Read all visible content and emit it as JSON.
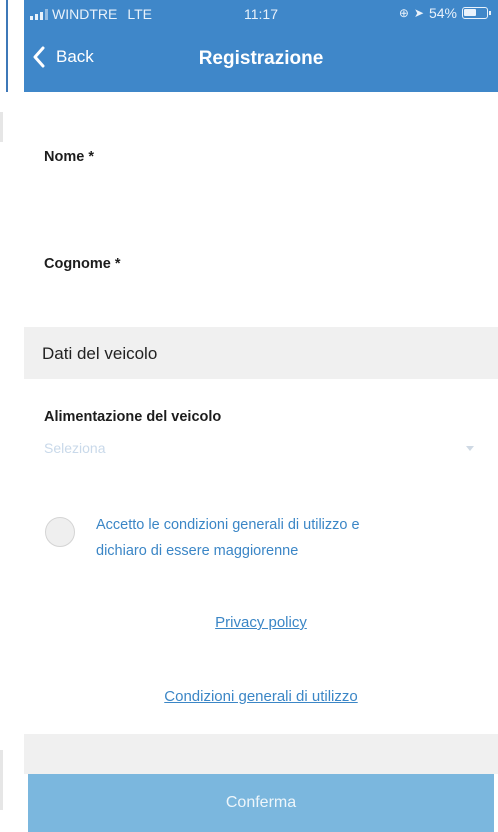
{
  "status_bar": {
    "carrier": "WINDTRE",
    "network": "LTE",
    "time": "11:17",
    "battery": "54%"
  },
  "navbar": {
    "back_label": "Back",
    "title": "Registrazione"
  },
  "form": {
    "nome_label": "Nome *",
    "cognome_label": "Cognome *",
    "section_title": "Dati del veicolo",
    "alimentazione_label": "Alimentazione del veicolo",
    "alimentazione_placeholder": "Seleziona",
    "consent_line1": "Accetto le condizioni generali di utilizzo e",
    "consent_line2": "dichiaro di essere maggiorenne",
    "privacy_link": "Privacy policy",
    "terms_link": "Condizioni generali di utilizzo",
    "confirm_label": "Conferma"
  },
  "colors": {
    "header": "#3f87c9",
    "link": "#3b86c6",
    "confirm_button": "#7bb7de"
  }
}
